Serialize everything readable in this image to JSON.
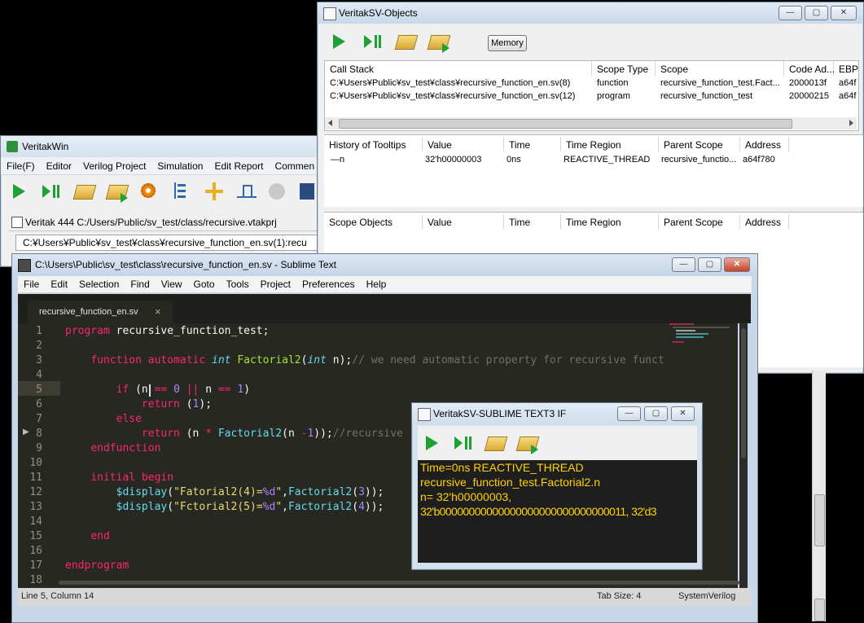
{
  "veritakwin": {
    "title": "VeritakWin",
    "menu": [
      "File(F)",
      "Editor",
      "Verilog Project",
      "Simulation",
      "Edit Report",
      "Commen"
    ],
    "project_title": "Veritak 444 C:/Users/Public/sv_test/class/recursive.vtakprj",
    "path_field": "C:¥Users¥Public¥sv_test¥class¥recursive_function_en.sv(1):recu"
  },
  "objects": {
    "title": "VeritakSV-Objects",
    "memory_button": "Memory",
    "callstack_headers": [
      "Call Stack",
      "Scope Type",
      "Scope",
      "Code Ad...",
      "EBP"
    ],
    "callstack_rows": [
      [
        "C:¥Users¥Public¥sv_test¥class¥recursive_function_en.sv(8)",
        "function",
        "recursive_function_test.Fact...",
        "2000013f",
        "a64f"
      ],
      [
        "C:¥Users¥Public¥sv_test¥class¥recursive_function_en.sv(12)",
        "program",
        "recursive_function_test",
        "20000215",
        "a64f"
      ]
    ],
    "history_headers": [
      "History of Tooltips",
      "Value",
      "Time",
      "Time Region",
      "Parent Scope",
      "Address"
    ],
    "history_rows": [
      [
        "—n",
        "32'h00000003",
        "0ns",
        "REACTIVE_THREAD",
        "recursive_functio...",
        "a64f780"
      ]
    ],
    "scope_headers": [
      "Scope Objects",
      "Value",
      "Time",
      "Time Region",
      "Parent Scope",
      "Address"
    ]
  },
  "sublime": {
    "title": "C:\\Users\\Public\\sv_test\\class\\recursive_function_en.sv - Sublime Text",
    "menu": [
      "File",
      "Edit",
      "Selection",
      "Find",
      "View",
      "Goto",
      "Tools",
      "Project",
      "Preferences",
      "Help"
    ],
    "tab_name": "recursive_function_en.sv",
    "tab_close": "×",
    "line_numbers": [
      "1",
      "2",
      "3",
      "4",
      "5",
      "6",
      "7",
      "8",
      "9",
      "10",
      "11",
      "12",
      "13",
      "14",
      "15",
      "16",
      "17",
      "18"
    ],
    "status_left": "Line 5, Column 14",
    "status_tab": "Tab Size: 4",
    "status_syntax": "SystemVerilog"
  },
  "ifwin": {
    "title": "VeritakSV-SUBLIME TEXT3 IF",
    "output_lines": [
      "Time=0ns REACTIVE_THREAD",
      "recursive_function_test.Factorial2.n",
      "n= 32'h00000003,",
      "32'b00000000000000000000000000000011, 32'd3"
    ]
  },
  "colors": {
    "editor_bg": "#272822",
    "output_bg": "#1e1e1e",
    "output_text": "#ffd200",
    "accent_green": "#1ea035"
  }
}
